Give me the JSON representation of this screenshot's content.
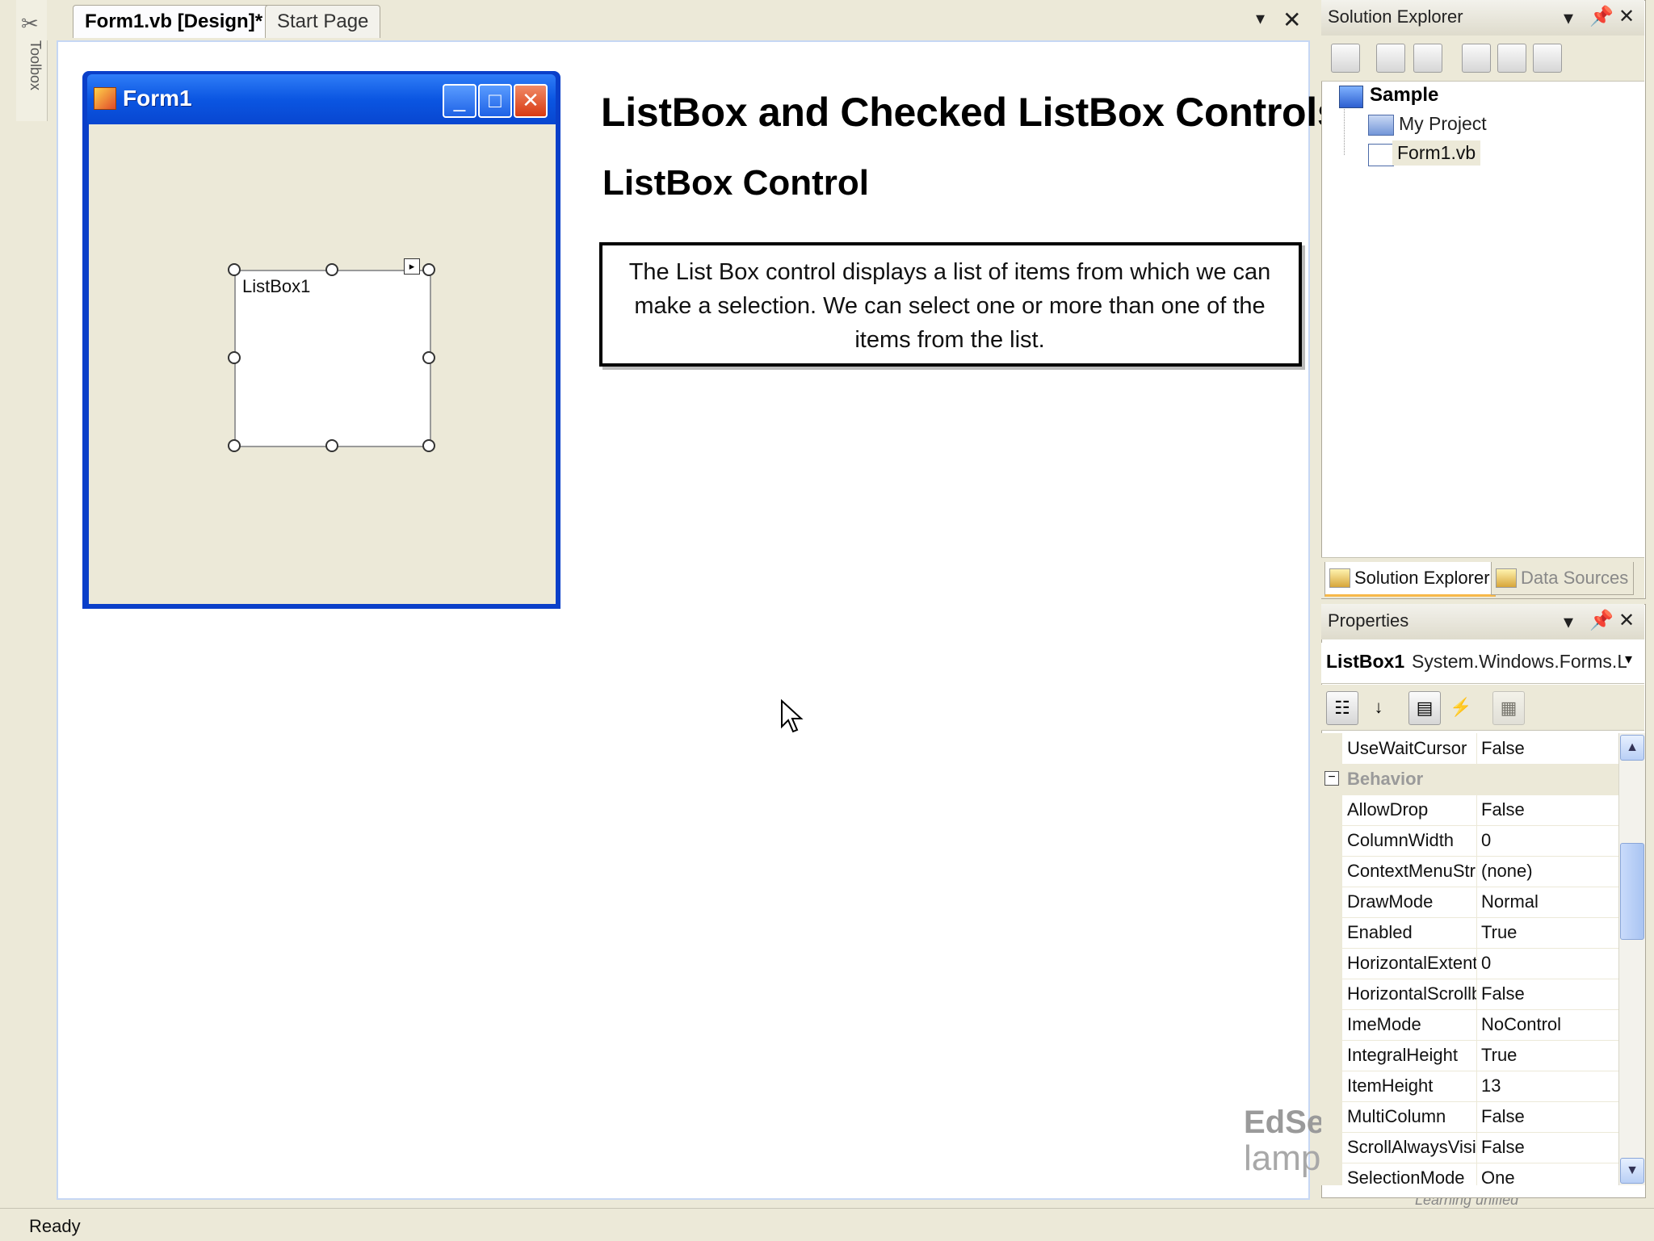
{
  "toolbox": {
    "label": "Toolbox"
  },
  "tabs": {
    "active": "Form1.vb [Design]*",
    "start": "Start Page",
    "dropdown": "▾",
    "close": "✕"
  },
  "form": {
    "title": "Form1",
    "min": "_",
    "max": "□",
    "close": "✕"
  },
  "listbox": {
    "name": "ListBox1"
  },
  "slide": {
    "title": "ListBox and Checked ListBox Controls",
    "subtitle": "ListBox Control",
    "description": "The List Box control displays a list of items from which we can make a selection. We can select one or more than one of the items from the list."
  },
  "solution_explorer": {
    "title": "Solution Explorer",
    "tree": {
      "solution": "Sample",
      "project": "My Project",
      "file": "Form1.vb"
    },
    "tabs": {
      "solution": "Solution Explorer",
      "data": "Data Sources"
    }
  },
  "properties": {
    "title": "Properties",
    "object_name": "ListBox1",
    "object_type": "System.Windows.Forms.Lis",
    "rows": [
      {
        "name": "UseWaitCursor",
        "value": "False"
      },
      {
        "name": "Behavior",
        "value": "",
        "category": true
      },
      {
        "name": "AllowDrop",
        "value": "False"
      },
      {
        "name": "ColumnWidth",
        "value": "0"
      },
      {
        "name": "ContextMenuStr",
        "value": "(none)"
      },
      {
        "name": "DrawMode",
        "value": "Normal"
      },
      {
        "name": "Enabled",
        "value": "True"
      },
      {
        "name": "HorizontalExtent",
        "value": "0"
      },
      {
        "name": "HorizontalScrollb",
        "value": "False"
      },
      {
        "name": "ImeMode",
        "value": "NoControl"
      },
      {
        "name": "IntegralHeight",
        "value": "True"
      },
      {
        "name": "ItemHeight",
        "value": "13"
      },
      {
        "name": "MultiColumn",
        "value": "False"
      },
      {
        "name": "ScrollAlwaysVisit",
        "value": "False"
      },
      {
        "name": "SelectionMode",
        "value": "One"
      }
    ]
  },
  "watermark": {
    "logo": "EdServ",
    "url": "lampsglow.com",
    "tagline": "Learning unified"
  },
  "status": {
    "text": "Ready"
  },
  "icons": {
    "toolbox": "toolbox-icon",
    "cursor": "mouse-pointer-icon",
    "pin": "pin-icon",
    "close": "close-icon",
    "dropdown": "chevron-down-icon"
  }
}
